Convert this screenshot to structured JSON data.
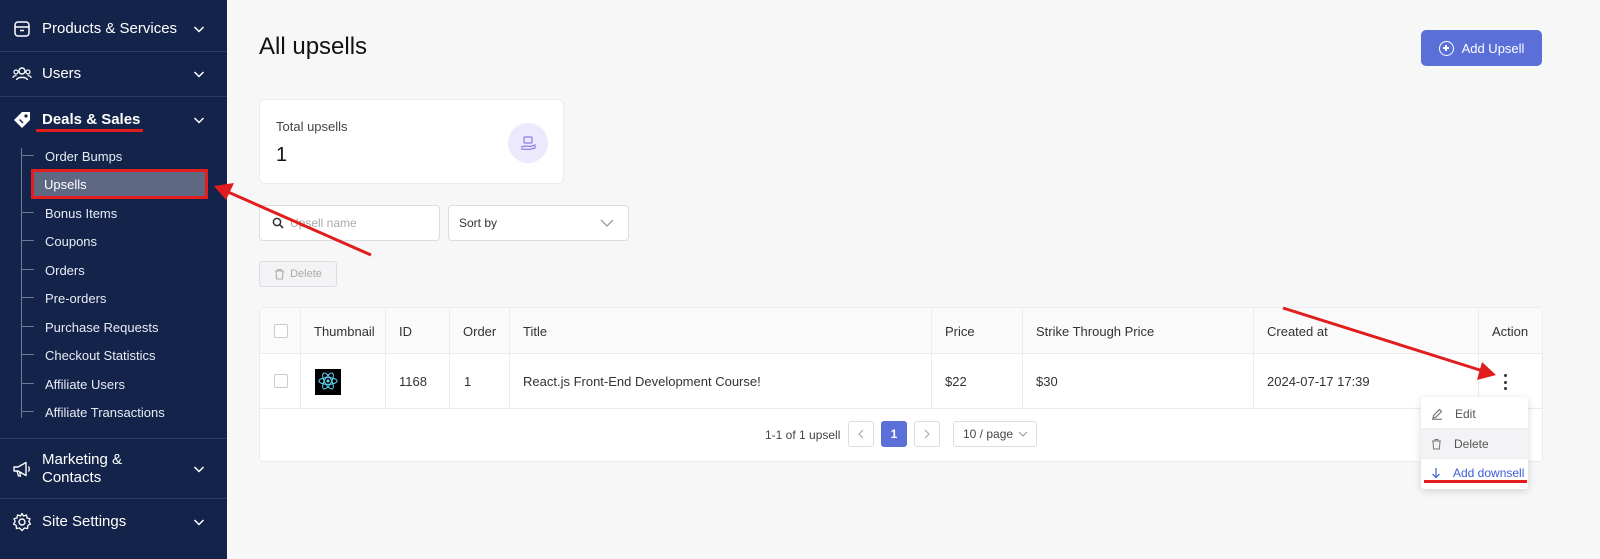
{
  "sidebar": {
    "groups": [
      {
        "label": "Products & Services",
        "icon": "box-icon"
      },
      {
        "label": "Users",
        "icon": "users-icon"
      },
      {
        "label": "Deals & Sales",
        "icon": "tag-icon"
      },
      {
        "label": "Marketing &\nContacts",
        "icon": "megaphone-icon"
      },
      {
        "label": "Site Settings",
        "icon": "gear-icon"
      }
    ],
    "deals_items": [
      "Order Bumps",
      "Upsells",
      "Bonus Items",
      "Coupons",
      "Orders",
      "Pre-orders",
      "Purchase Requests",
      "Checkout Statistics",
      "Affiliate Users",
      "Affiliate Transactions"
    ],
    "active_item": "Upsells"
  },
  "header": {
    "title": "All upsells",
    "add_button": "Add Upsell"
  },
  "stats": {
    "label": "Total upsells",
    "value": "1"
  },
  "filters": {
    "search_placeholder": "Upsell name",
    "sort_label": "Sort by",
    "delete_label": "Delete"
  },
  "table": {
    "columns": [
      "Thumbnail",
      "ID",
      "Order",
      "Title",
      "Price",
      "Strike Through Price",
      "Created at",
      "Action"
    ],
    "rows": [
      {
        "thumbnail": "react-logo-icon",
        "id": "1168",
        "order": "1",
        "title": "React.js Front-End Development Course!",
        "price": "$22",
        "strike_price": "$30",
        "created_at": "2024-07-17 17:39"
      }
    ]
  },
  "pagination": {
    "summary": "1-1 of 1 upsell",
    "current_page": "1",
    "page_size": "10 / page"
  },
  "action_menu": {
    "edit": "Edit",
    "delete": "Delete",
    "add_downsell": "Add downsell"
  },
  "colors": {
    "sidebar_bg": "#13234a",
    "accent": "#5a6fd8",
    "annotation": "#e11d1d"
  }
}
